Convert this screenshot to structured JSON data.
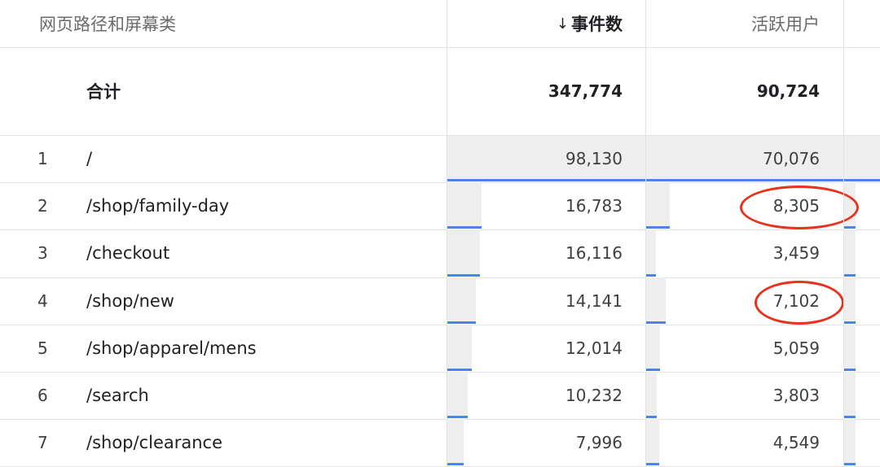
{
  "header": {
    "dimension_label": "网页路径和屏幕类",
    "sort_arrow": "↓",
    "col_events": "事件数",
    "col_users": "活跃用户"
  },
  "total": {
    "label": "合计",
    "events": "347,774",
    "users": "90,724"
  },
  "rows": [
    {
      "index": "1",
      "path": "/",
      "events": "98,130",
      "users": "70,076",
      "events_share": 1.0,
      "users_share": 1.0
    },
    {
      "index": "2",
      "path": "/shop/family-day",
      "events": "16,783",
      "users": "8,305",
      "events_share": 0.171,
      "users_share": 0.1185
    },
    {
      "index": "3",
      "path": "/checkout",
      "events": "16,116",
      "users": "3,459",
      "events_share": 0.164,
      "users_share": 0.049
    },
    {
      "index": "4",
      "path": "/shop/new",
      "events": "14,141",
      "users": "7,102",
      "events_share": 0.144,
      "users_share": 0.101
    },
    {
      "index": "5",
      "path": "/shop/apparel/mens",
      "events": "12,014",
      "users": "5,059",
      "events_share": 0.122,
      "users_share": 0.072
    },
    {
      "index": "6",
      "path": "/search",
      "events": "10,232",
      "users": "3,803",
      "events_share": 0.104,
      "users_share": 0.054
    },
    {
      "index": "7",
      "path": "/shop/clearance",
      "events": "7,996",
      "users": "4,549",
      "events_share": 0.081,
      "users_share": 0.065
    }
  ],
  "highlighted_values": [
    "8,305",
    "7,102"
  ],
  "colors": {
    "bar_accent": "#4a86e8",
    "highlight_circle": "#e8321e"
  }
}
